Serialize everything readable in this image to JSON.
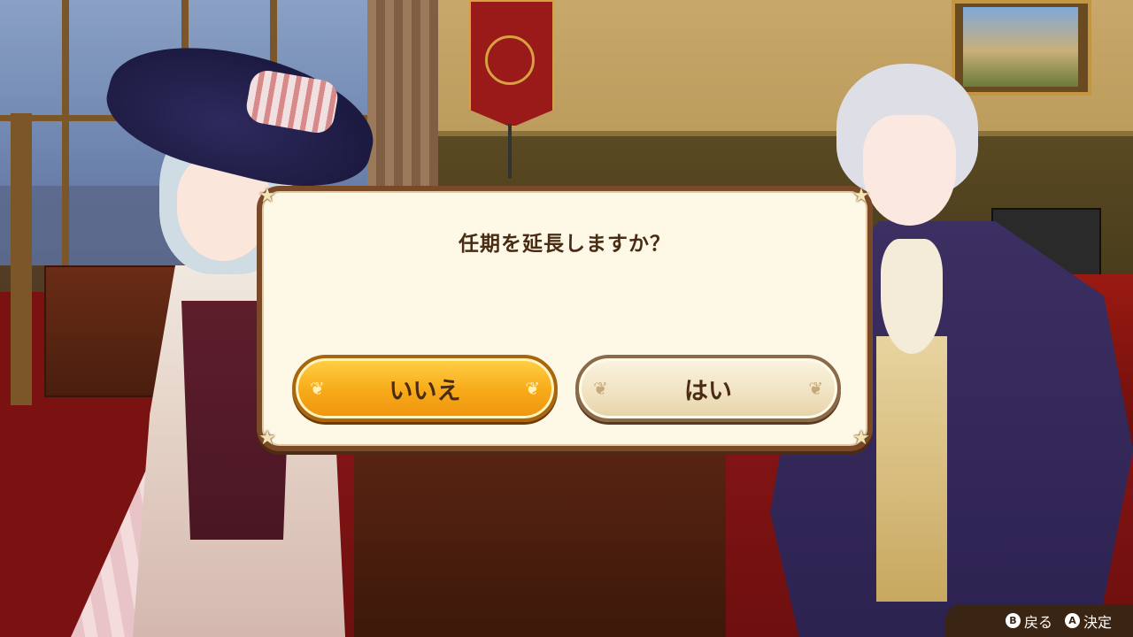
{
  "dialog": {
    "question": "任期を延長しますか？",
    "no_label": "いいえ",
    "yes_label": "はい",
    "corner_glyph": "★",
    "ornament_glyph": "❦"
  },
  "controls": {
    "back": {
      "key": "B",
      "label": "戻る"
    },
    "confirm": {
      "key": "A",
      "label": "決定"
    }
  },
  "colors": {
    "dialog_bg": "#fdf9e6",
    "dialog_border": "#7a4a28",
    "button_selected": "#f7a918",
    "button_unselected": "#f0e2c0",
    "text": "#4a2c14"
  },
  "selected_button": "no"
}
